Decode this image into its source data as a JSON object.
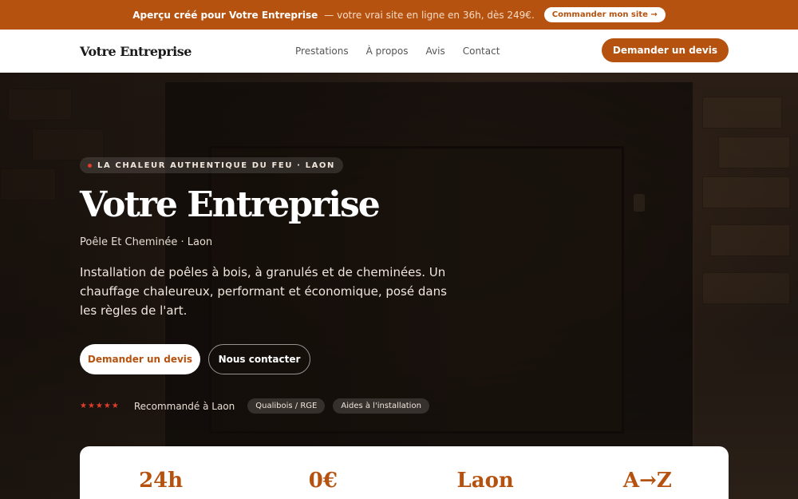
{
  "topbar": {
    "lead": "Aperçu créé pour Votre Entreprise",
    "rest": "— votre vrai site en ligne en 36h, dès 249€.",
    "order_label": "Commander mon site →"
  },
  "nav": {
    "logo": "Votre Entreprise",
    "links": [
      "Prestations",
      "À propos",
      "Avis",
      "Contact"
    ],
    "cta": "Demander un devis"
  },
  "hero": {
    "badge": "LA CHALEUR AUTHENTIQUE DU FEU · LAON",
    "title": "Votre Entreprise",
    "subtitle": "Poêle Et Cheminée · Laon",
    "description": "Installation de poêles à bois, à granulés et de cheminées. Un chauffage chaleureux, performant et économique, posé dans les règles de l'art.",
    "primary_button": "Demander un devis",
    "secondary_button": "Nous contacter",
    "stars": "★★★★★",
    "recommended": "Recommandé à Laon",
    "pills": [
      "Qualibois / RGE",
      "Aides à l'installation"
    ]
  },
  "stats": [
    "24h",
    "0€",
    "Laon",
    "A→Z"
  ],
  "colors": {
    "accent": "#b5520f",
    "star": "#e23d2c"
  }
}
